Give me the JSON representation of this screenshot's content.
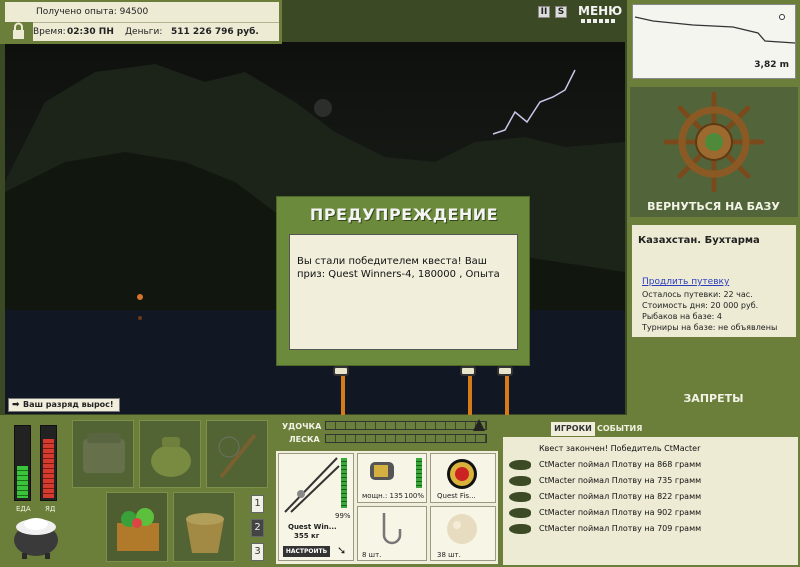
{
  "info": {
    "experience_label": "Получено опыта: 94500",
    "time_label": "Время:",
    "time_value": "02:30 ПН",
    "money_label": "Деньги:",
    "money_value": "511 226 796 руб."
  },
  "top_buttons": {
    "pause": "II",
    "sound": "S",
    "menu": "МЕНЮ"
  },
  "depth": {
    "value": "3,82 m"
  },
  "right_panel": {
    "return_label": "ВЕРНУТЬСЯ НА БАЗУ",
    "place": "Казахстан. Бухтарма",
    "extend_link": "Продлить путевку",
    "lines": [
      "Осталось путевки: 22 час.",
      "Стоимость дня: 20 000 руб.",
      "Рыбаков на базе: 4",
      "Турниры на базе: не объявлены"
    ],
    "bans_label": "ЗАПРЕТЫ"
  },
  "dialog": {
    "title": "ПРЕДУПРЕЖДЕНИЕ",
    "message": "Вы стали победителем квеста! Ваш приз: Quest Winners-4, 180000 , Опыта"
  },
  "rank_notice": "Ваш разряд вырос!",
  "meters": {
    "food_label": "ЕДА",
    "poison_label": "ЯД",
    "food_level": 0.45,
    "poison_level": 0.82
  },
  "inventory_pages": [
    "1",
    "2",
    "3"
  ],
  "tackle": {
    "rod_label": "УДОЧКА",
    "line_label": "ЛЕСКА",
    "rod_name": "Quest Win...",
    "rod_weight": "355 кг",
    "rod_percent": "99%",
    "reel_power": "мощн.: 135",
    "reel_percent": "100%",
    "lure_name": "Quest Fis...",
    "hook_count": "8 шт.",
    "bait_count": "38 шт.",
    "setup_button": "НАСТРОИТЬ"
  },
  "events": {
    "tabs": [
      "ИГРОКИ",
      "СОБЫТИЯ"
    ],
    "header": "Квест закончен! Победитель CtMacter",
    "items": [
      "CtMacter поймал Плотву на 868 грамм",
      "CtMacter поймал Плотву на 735 грамм",
      "CtMacter поймал Плотву на 822 грамм",
      "CtMacter поймал Плотву на 902 грамм",
      "CtMacter поймал Плотву на 709 грамм"
    ]
  },
  "colors": {
    "panel_green": "#6b7f3b",
    "dialog_green": "#6b8a3c",
    "cream": "#eeebd5",
    "pole_orange": "#d77a1a"
  }
}
